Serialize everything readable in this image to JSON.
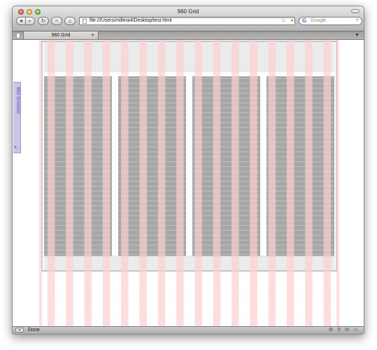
{
  "window": {
    "title": "960 Grid"
  },
  "toolbar": {
    "back_glyph": "◂",
    "forward_glyph": "▸",
    "reload_glyph": "↻",
    "stop_glyph": "✕",
    "home_glyph": "⌂",
    "url": "file:///Users/millera4/Desktop/test.html",
    "bookmark_glyph": "☆",
    "url_dropdown_glyph": "▾",
    "search_engine_glyph": "G",
    "search_placeholder": "Google",
    "search_glyph": "⌕"
  },
  "tabs": {
    "active_label": "960 Grid",
    "new_tab_glyph": "+",
    "menu_glyph": "▼"
  },
  "gridder": {
    "label": "960 Gridder",
    "toggle_glyph": "»"
  },
  "status": {
    "text": "Done",
    "menu_glyph": "▾",
    "icons_text": "⚙ ⚲ ✉ ☺"
  },
  "grid": {
    "columns": 16,
    "column_color": "#fcd0d0",
    "block_color": "#a6a6a6",
    "band_color": "#ebebeb",
    "gridline_color": "#fff0f0",
    "dark_blocks": 4
  },
  "colors": {
    "gridder_tab": "#c9c6e8",
    "gridder_text": "#7a74c6",
    "chrome": "#b4b4b4"
  }
}
